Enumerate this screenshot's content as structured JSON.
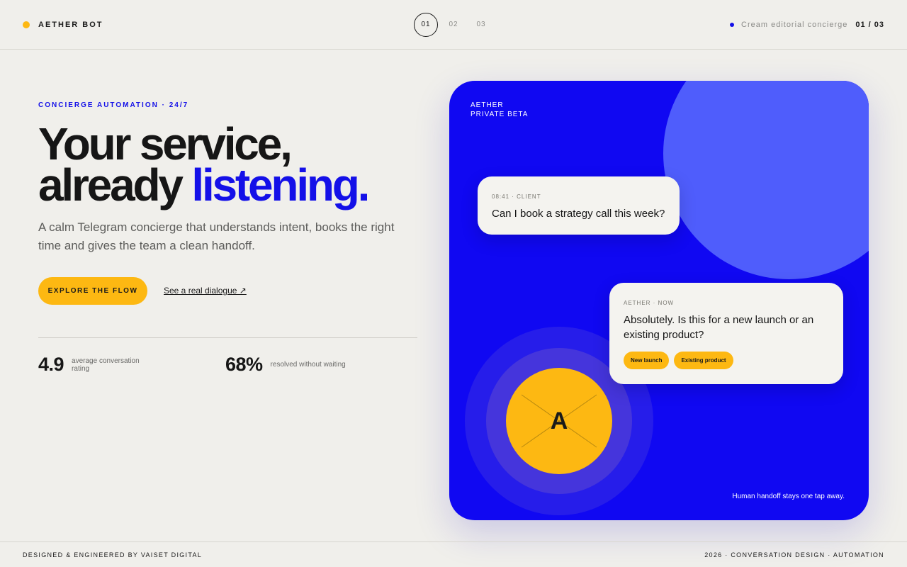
{
  "header": {
    "brand": "AETHER BOT",
    "steps": [
      "01",
      "02",
      "03"
    ],
    "active_step": "01",
    "tagline": "Cream editorial concierge",
    "counter": "01 / 03"
  },
  "hero": {
    "eyebrow": "CONCIERGE AUTOMATION · 24/7",
    "headline_line1": "Your service,",
    "headline_line2": "already",
    "headline_accent": "listening.",
    "subtext": "A calm Telegram concierge that understands intent, books the right time and gives the team a clean handoff.",
    "primary_cta": "EXPLORE THE FLOW",
    "secondary_cta": "See a real dialogue ↗"
  },
  "stats": [
    {
      "value": "4.9",
      "label": "average conversation rating"
    },
    {
      "value": "68%",
      "label": "resolved without waiting"
    }
  ],
  "card": {
    "tag_line1": "AETHER",
    "tag_line2": "PRIVATE BETA",
    "client_bubble": {
      "meta": "08:41 · CLIENT",
      "text": "Can I book a strategy call this week?"
    },
    "bot_bubble": {
      "meta": "AETHER · NOW",
      "text": "Absolutely. Is this for a new launch or an existing product?",
      "chips": [
        "New launch",
        "Existing product"
      ]
    },
    "avatar_letter": "A",
    "handoff_note": "Human handoff stays one tap away."
  },
  "footer": {
    "left": "DESIGNED & ENGINEERED BY VAISET DIGITAL",
    "right": "2026 · CONVERSATION DESIGN · AUTOMATION"
  },
  "colors": {
    "background": "#f0efeb",
    "accent_blue": "#1410e8",
    "card_blue": "#1008f2",
    "accent_yellow": "#fdb812",
    "circle_blue": "#4f5dfc"
  }
}
